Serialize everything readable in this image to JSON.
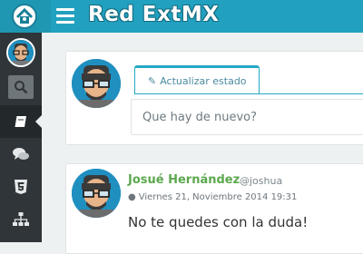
{
  "header": {
    "brand": "Red ExtMX",
    "logo_icon": "house-logo-icon",
    "menu_icon": "hamburger-icon",
    "color": "#21a1bf"
  },
  "sidebar": {
    "items": [
      {
        "name": "avatar",
        "icon": "user-avatar"
      },
      {
        "name": "search",
        "icon": "search-icon"
      },
      {
        "name": "notes",
        "icon": "book-icon",
        "active": true
      },
      {
        "name": "chat",
        "icon": "chat-bubbles-icon"
      },
      {
        "name": "html5",
        "icon": "html5-icon"
      },
      {
        "name": "tree",
        "icon": "sitemap-icon"
      }
    ]
  },
  "composer": {
    "tab_label": "Actualizar estado",
    "placeholder": "Que hay de nuevo?"
  },
  "post": {
    "author": "Josué Hernández",
    "handle": "@joshua",
    "date": "Viernes 21, Noviembre 2014 19:31",
    "text": "No te quedes con la duda!"
  }
}
